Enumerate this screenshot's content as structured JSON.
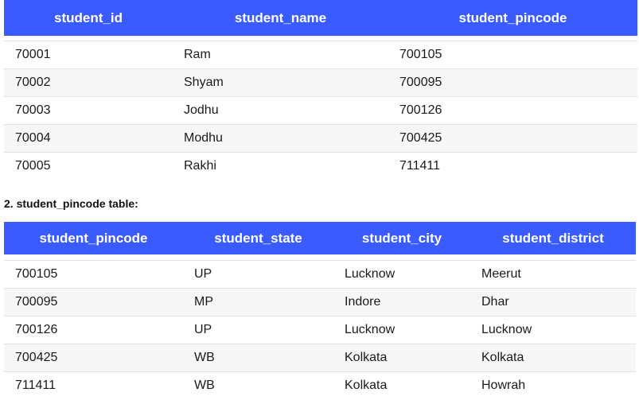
{
  "table1": {
    "headers": [
      "student_id",
      "student_name",
      "student_pincode"
    ],
    "rows": [
      [
        "70001",
        "Ram",
        "700105"
      ],
      [
        "70002",
        "Shyam",
        "700095"
      ],
      [
        "70003",
        "Jodhu",
        "700126"
      ],
      [
        "70004",
        "Modhu",
        "700425"
      ],
      [
        "70005",
        "Rakhi",
        "711411"
      ]
    ]
  },
  "section2": {
    "title": "2. student_pincode table:"
  },
  "table2": {
    "headers": [
      "student_pincode",
      "student_state",
      "student_city",
      "student_district"
    ],
    "rows": [
      [
        "700105",
        "UP",
        "Lucknow",
        "Meerut"
      ],
      [
        "700095",
        "MP",
        "Indore",
        "Dhar"
      ],
      [
        "700126",
        "UP",
        "Lucknow",
        "Lucknow"
      ],
      [
        "700425",
        "WB",
        "Kolkata",
        "Kolkata"
      ],
      [
        "711411",
        "WB",
        "Kolkata",
        "Howrah"
      ]
    ]
  },
  "colors": {
    "header_bg": "#3a5bff",
    "header_text": "#ffffff",
    "row_alt_bg": "#f7f7f7"
  }
}
